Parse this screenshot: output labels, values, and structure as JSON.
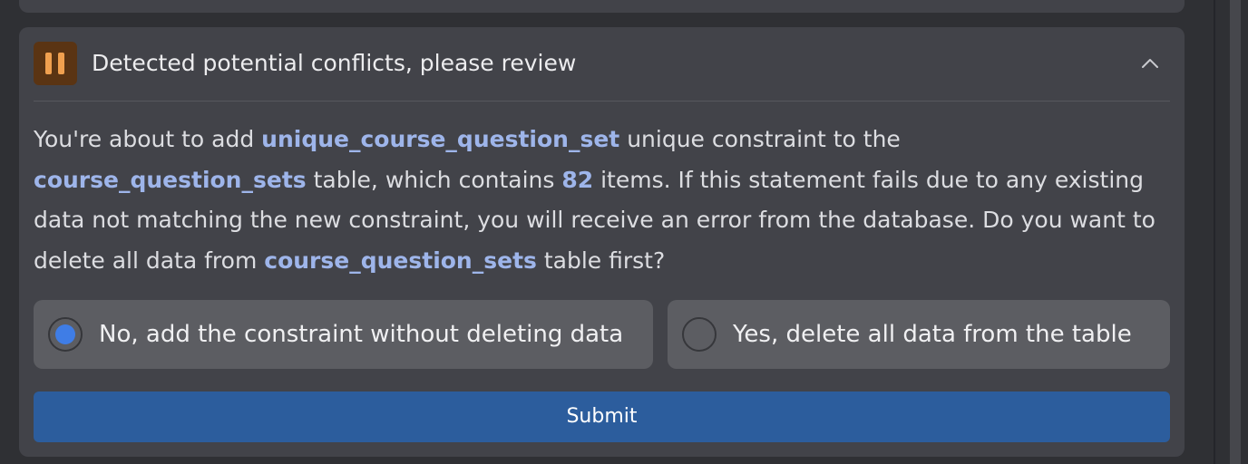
{
  "colors": {
    "background": "#2f3034",
    "card": "#424349",
    "option": "#5c5d62",
    "highlight": "#9eb5ea",
    "warning_badge_bg": "#5a3413",
    "warning_badge_fg": "#f0a04f",
    "radio_selected": "#3f7de6",
    "submit_bg": "#2c5d9d"
  },
  "panel": {
    "status_icon": "pause-icon",
    "title": "Detected potential conflicts, please review",
    "collapse_icon": "chevron-up-icon",
    "expanded": true
  },
  "message": {
    "p1": "You're about to add ",
    "constraint_name": "unique_course_question_set",
    "p2": " unique constraint to the ",
    "table_name": "course_question_sets",
    "p3": " table, which contains ",
    "item_count": "82",
    "p4": " items. If this statement fails due to any existing data not matching the new constraint, you will receive an error from the database. Do you want to delete all data from ",
    "table_name_2": "course_question_sets",
    "p5": " table first?"
  },
  "options": [
    {
      "label": "No, add the constraint without deleting data",
      "selected": true
    },
    {
      "label": "Yes, delete all data from the table",
      "selected": false
    }
  ],
  "submit_label": "Submit"
}
